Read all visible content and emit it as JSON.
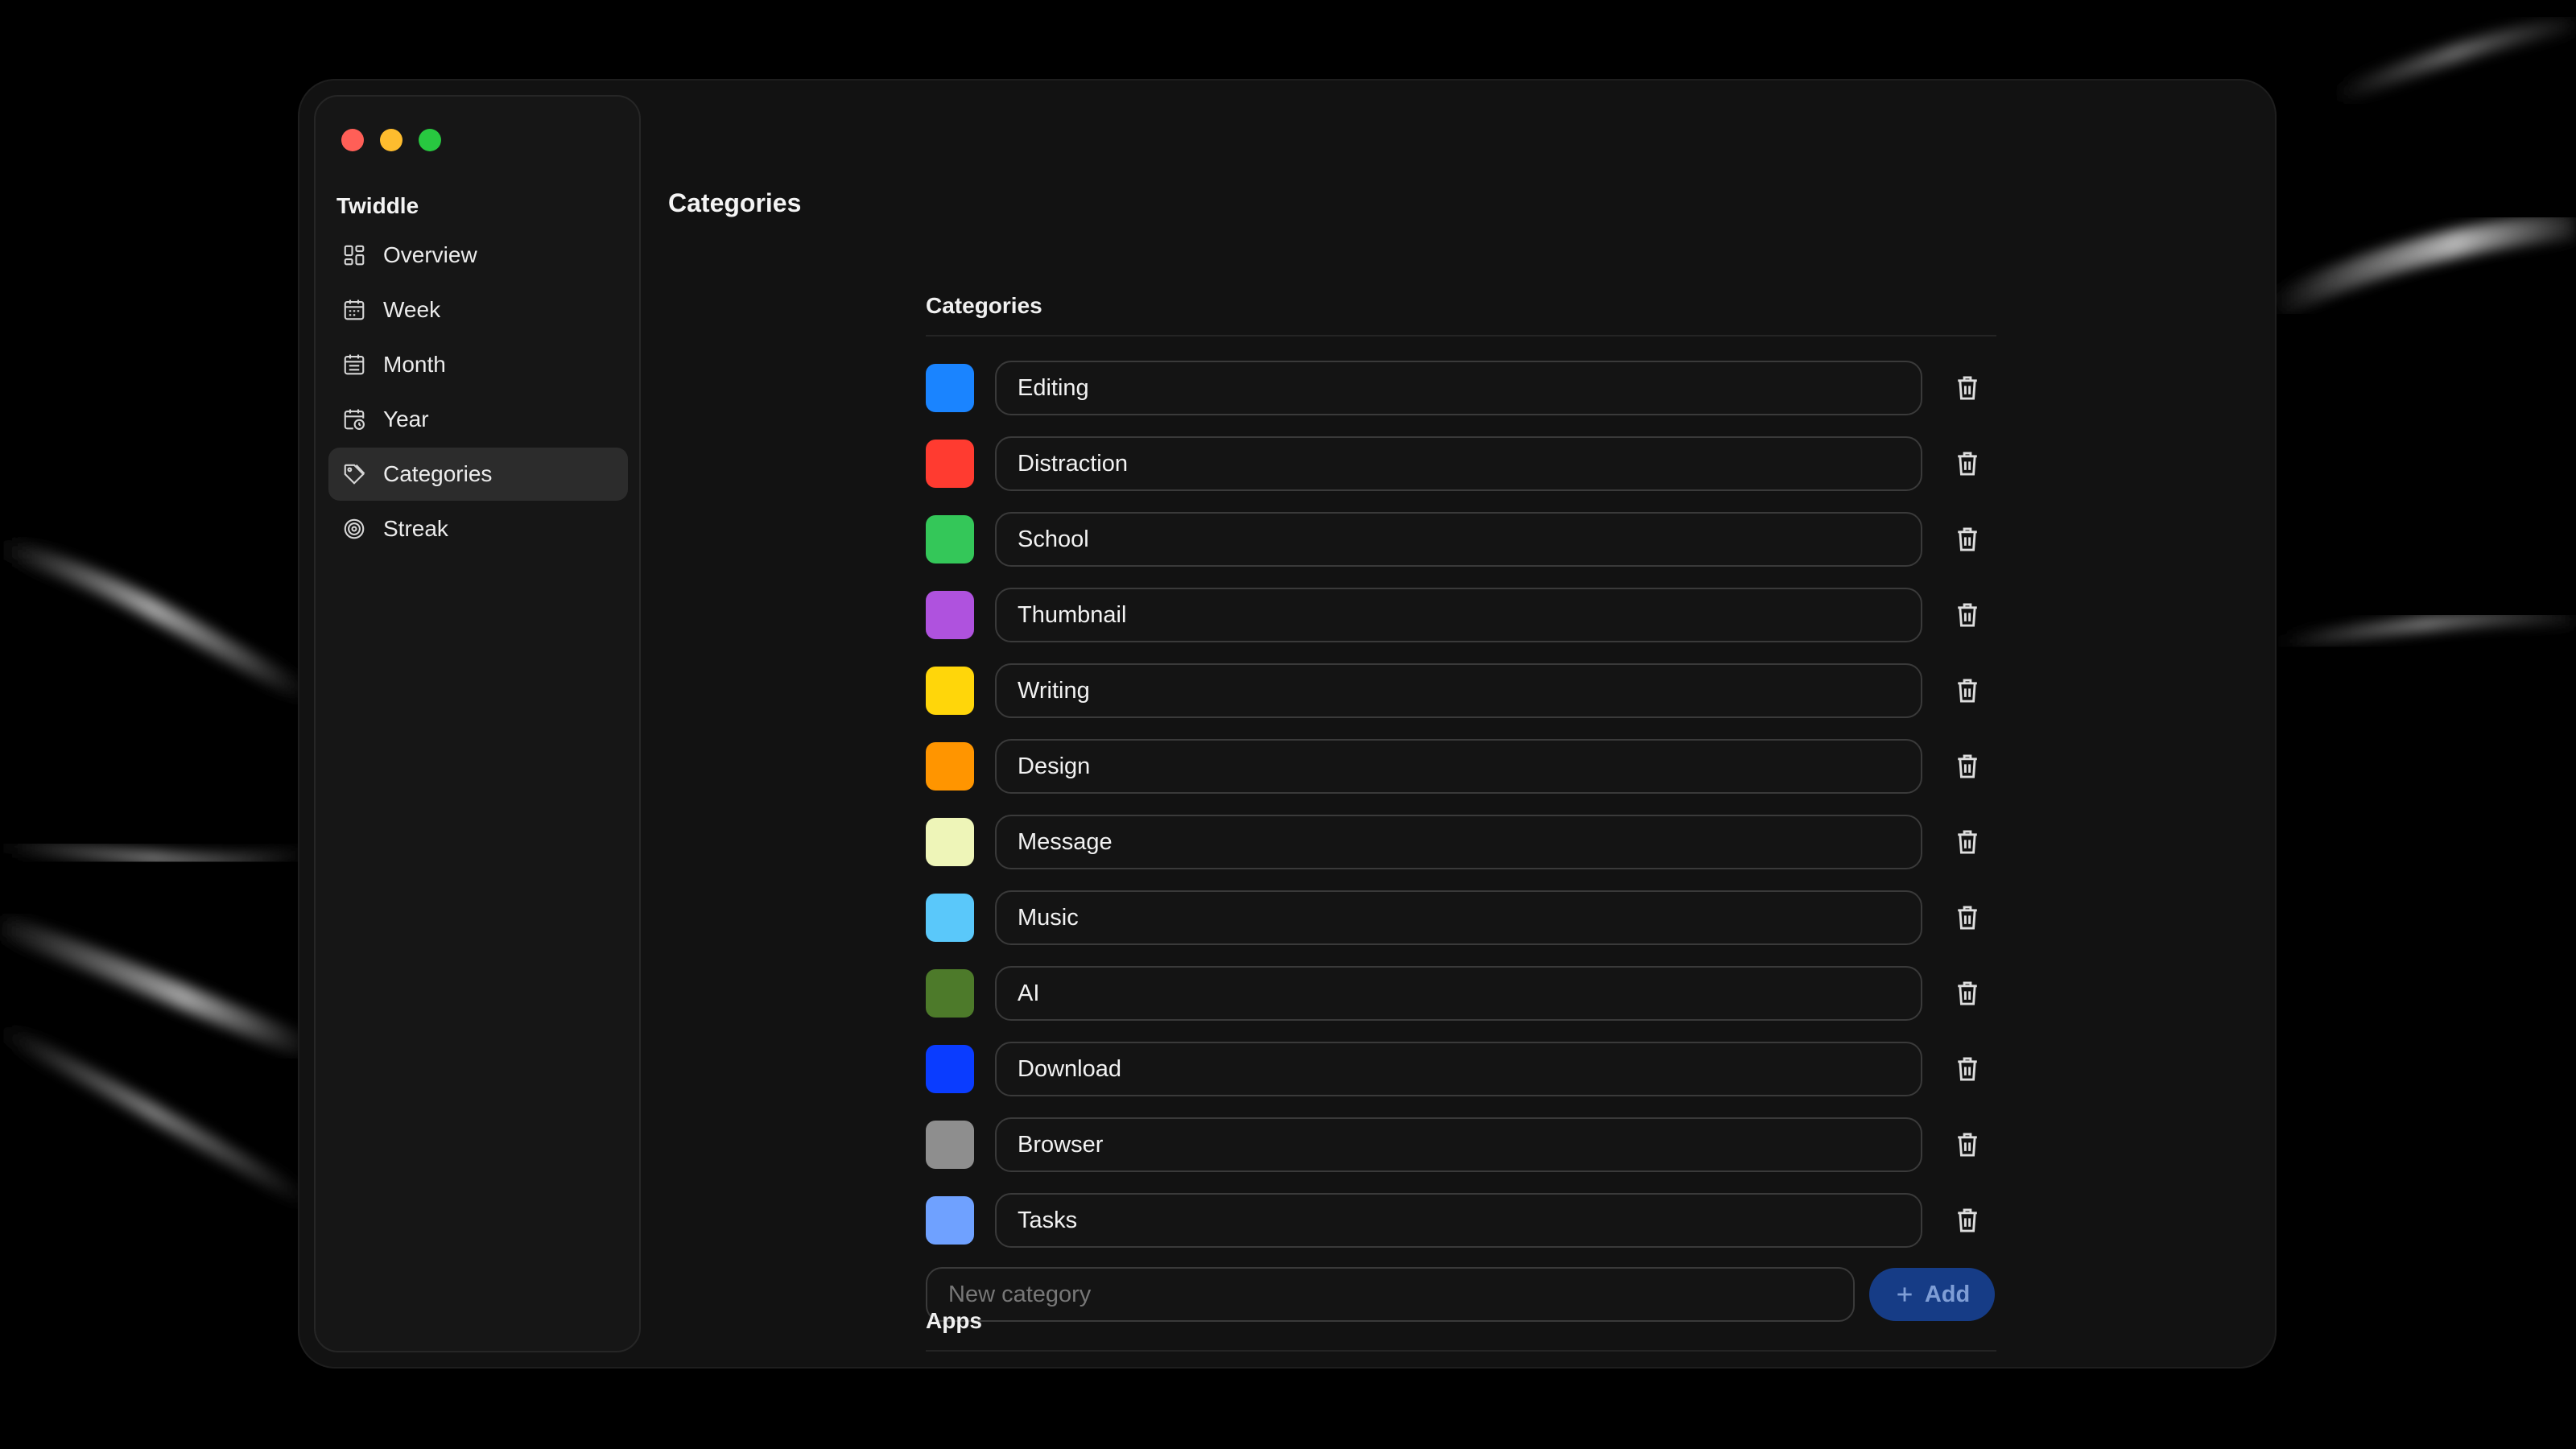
{
  "window": {
    "title": "Categories"
  },
  "sidebar": {
    "app_name": "Twiddle",
    "items": [
      {
        "label": "Overview",
        "icon": "grid-icon",
        "active": false
      },
      {
        "label": "Week",
        "icon": "calendar-week-icon",
        "active": false
      },
      {
        "label": "Month",
        "icon": "calendar-month-icon",
        "active": false
      },
      {
        "label": "Year",
        "icon": "calendar-clock-icon",
        "active": false
      },
      {
        "label": "Categories",
        "icon": "tag-icon",
        "active": true
      },
      {
        "label": "Streak",
        "icon": "target-icon",
        "active": false
      }
    ]
  },
  "categories_section": {
    "header": "Categories",
    "items": [
      {
        "name": "Editing",
        "color": "#1a84ff"
      },
      {
        "name": "Distraction",
        "color": "#ff3b30"
      },
      {
        "name": "School",
        "color": "#34c759"
      },
      {
        "name": "Thumbnail",
        "color": "#af52de"
      },
      {
        "name": "Writing",
        "color": "#ffd60a"
      },
      {
        "name": "Design",
        "color": "#ff9500"
      },
      {
        "name": "Message",
        "color": "#eef5b8"
      },
      {
        "name": "Music",
        "color": "#5ac8fa"
      },
      {
        "name": "AI",
        "color": "#4d7a2a"
      },
      {
        "name": "Download",
        "color": "#0a3cff"
      },
      {
        "name": "Browser",
        "color": "#8e8e8e"
      },
      {
        "name": "Tasks",
        "color": "#6fa1ff"
      }
    ],
    "new_category_placeholder": "New category",
    "add_label": "Add"
  },
  "apps_section": {
    "header": "Apps"
  }
}
